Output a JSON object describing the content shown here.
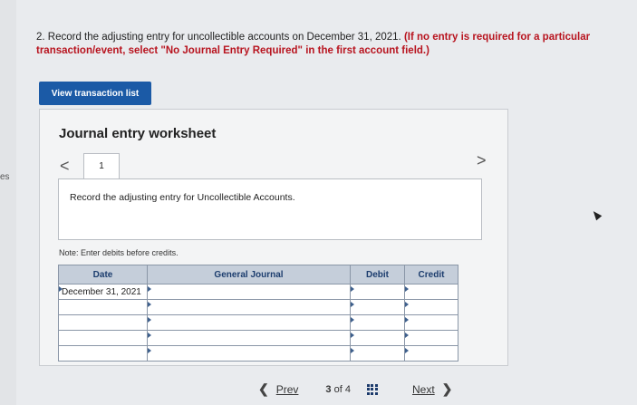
{
  "sidebar": {
    "tab_fragment": "es"
  },
  "question": {
    "number_text": "2. Record the adjusting entry for uncollectible accounts on December 31, 2021.",
    "instruction": "(If no entry is required for a particular transaction/event, select \"No Journal Entry Required\" in the first account field.)"
  },
  "buttons": {
    "view_transactions": "View transaction list"
  },
  "worksheet": {
    "title": "Journal entry worksheet",
    "nav_prev": "<",
    "nav_next": ">",
    "active_tab": "1",
    "instruction_text": "Record the adjusting entry for Uncollectible Accounts.",
    "note": "Note: Enter debits before credits."
  },
  "journal": {
    "headers": {
      "date": "Date",
      "general_journal": "General Journal",
      "debit": "Debit",
      "credit": "Credit"
    },
    "rows": [
      {
        "date": "December 31, 2021",
        "account": "",
        "debit": "",
        "credit": ""
      },
      {
        "date": "",
        "account": "",
        "debit": "",
        "credit": ""
      },
      {
        "date": "",
        "account": "",
        "debit": "",
        "credit": ""
      },
      {
        "date": "",
        "account": "",
        "debit": "",
        "credit": ""
      },
      {
        "date": "",
        "account": "",
        "debit": "",
        "credit": ""
      }
    ]
  },
  "pagination": {
    "prev_label": "Prev",
    "current": "3",
    "of_label": "of",
    "total": "4",
    "next_label": "Next"
  },
  "icons": {
    "prev": "chevron-left-icon",
    "next": "chevron-right-icon",
    "grid": "grid-icon"
  },
  "colors": {
    "primary_button": "#1b5aa6",
    "instruction_red": "#b8141f",
    "table_header": "#c5ceda"
  }
}
